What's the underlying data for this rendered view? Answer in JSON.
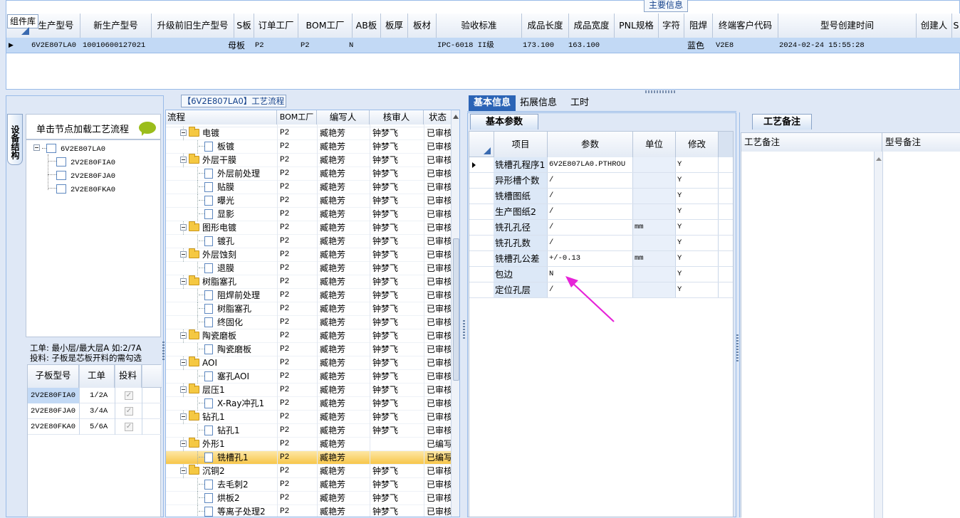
{
  "top_panel": {
    "component_lib_label": "组件库",
    "main_info_tab": "主要信息",
    "columns": [
      "生产型号",
      "新生产型号",
      "升级前旧生产型号",
      "S板",
      "订单工厂",
      "BOM工厂",
      "AB板",
      "板厚",
      "板材",
      "验收标准",
      "成品长度",
      "成品宽度",
      "PNL规格",
      "字符",
      "阻焊",
      "终端客户代码",
      "型号创建时间",
      "创建人",
      "S"
    ],
    "row": {
      "marker": "▶",
      "prod_model": "6V2E807LA0",
      "new_model": "10010600127021",
      "old_model": "",
      "s_board": "母板",
      "order_factory": "P2",
      "bom_factory": "P2",
      "ab_board": "N",
      "thickness": "",
      "material": "",
      "standard": "IPC-6018 II级",
      "length": "173.100",
      "width": "163.100",
      "pnl": "",
      "char": "",
      "solder": "蓝色",
      "customer": "V2E8",
      "created": "2024-02-24 15:55:28",
      "creator": ""
    }
  },
  "left_panel": {
    "vertical_tab": "设备结构",
    "load_hint": "单击节点加载工艺流程",
    "tree_root": "6V2E807LA0",
    "tree_children": [
      "2V2E80FIA0",
      "2V2E80FJA0",
      "2V2E80FKA0"
    ],
    "note_line1": "工单: 最小层/最大层A 如:2/7A",
    "note_line2": "投料: 子板是芯板开料的需勾选",
    "sub_table": {
      "headers": [
        "子板型号",
        "工单",
        "投料"
      ],
      "rows": [
        {
          "model": "2V2E80FIA0",
          "order": "1/2A",
          "feed": "✓"
        },
        {
          "model": "2V2E80FJA0",
          "order": "3/4A",
          "feed": "✓"
        },
        {
          "model": "2V2E80FKA0",
          "order": "5/6A",
          "feed": "✓"
        }
      ]
    }
  },
  "process_panel": {
    "title": "【6V2E807LA0】工艺流程",
    "headers": [
      "流程",
      "BOM工厂",
      "编写人",
      "核审人",
      "状态"
    ],
    "rows": [
      {
        "name": "电镀",
        "type": "folder",
        "bom": "P2",
        "writer": "臧艳芳",
        "reviewer": "钟梦飞",
        "status": "已审核"
      },
      {
        "name": "板镀",
        "type": "doc",
        "bom": "P2",
        "writer": "臧艳芳",
        "reviewer": "钟梦飞",
        "status": "已审核"
      },
      {
        "name": "外层干膜",
        "type": "folder",
        "bom": "P2",
        "writer": "臧艳芳",
        "reviewer": "钟梦飞",
        "status": "已审核"
      },
      {
        "name": "外层前处理",
        "type": "doc",
        "bom": "P2",
        "writer": "臧艳芳",
        "reviewer": "钟梦飞",
        "status": "已审核"
      },
      {
        "name": "贴膜",
        "type": "doc",
        "bom": "P2",
        "writer": "臧艳芳",
        "reviewer": "钟梦飞",
        "status": "已审核"
      },
      {
        "name": "曝光",
        "type": "doc",
        "bom": "P2",
        "writer": "臧艳芳",
        "reviewer": "钟梦飞",
        "status": "已审核"
      },
      {
        "name": "显影",
        "type": "doc",
        "bom": "P2",
        "writer": "臧艳芳",
        "reviewer": "钟梦飞",
        "status": "已审核"
      },
      {
        "name": "图形电镀",
        "type": "folder",
        "bom": "P2",
        "writer": "臧艳芳",
        "reviewer": "钟梦飞",
        "status": "已审核"
      },
      {
        "name": "镀孔",
        "type": "doc",
        "bom": "P2",
        "writer": "臧艳芳",
        "reviewer": "钟梦飞",
        "status": "已审核"
      },
      {
        "name": "外层蚀刻",
        "type": "folder",
        "bom": "P2",
        "writer": "臧艳芳",
        "reviewer": "钟梦飞",
        "status": "已审核"
      },
      {
        "name": "退膜",
        "type": "doc",
        "bom": "P2",
        "writer": "臧艳芳",
        "reviewer": "钟梦飞",
        "status": "已审核"
      },
      {
        "name": "树脂塞孔",
        "type": "folder",
        "bom": "P2",
        "writer": "臧艳芳",
        "reviewer": "钟梦飞",
        "status": "已审核"
      },
      {
        "name": "阻焊前处理",
        "type": "doc",
        "bom": "P2",
        "writer": "臧艳芳",
        "reviewer": "钟梦飞",
        "status": "已审核"
      },
      {
        "name": "树脂塞孔",
        "type": "doc",
        "bom": "P2",
        "writer": "臧艳芳",
        "reviewer": "钟梦飞",
        "status": "已审核"
      },
      {
        "name": "终固化",
        "type": "doc",
        "bom": "P2",
        "writer": "臧艳芳",
        "reviewer": "钟梦飞",
        "status": "已审核"
      },
      {
        "name": "陶瓷磨板",
        "type": "folder",
        "bom": "P2",
        "writer": "臧艳芳",
        "reviewer": "钟梦飞",
        "status": "已审核"
      },
      {
        "name": "陶瓷磨板",
        "type": "doc",
        "bom": "P2",
        "writer": "臧艳芳",
        "reviewer": "钟梦飞",
        "status": "已审核"
      },
      {
        "name": "AOI",
        "type": "folder",
        "bom": "P2",
        "writer": "臧艳芳",
        "reviewer": "钟梦飞",
        "status": "已审核"
      },
      {
        "name": "塞孔AOI",
        "type": "doc",
        "bom": "P2",
        "writer": "臧艳芳",
        "reviewer": "钟梦飞",
        "status": "已审核"
      },
      {
        "name": "层压1",
        "type": "folder",
        "bom": "P2",
        "writer": "臧艳芳",
        "reviewer": "钟梦飞",
        "status": "已审核"
      },
      {
        "name": "X-Ray冲孔1",
        "type": "doc",
        "bom": "P2",
        "writer": "臧艳芳",
        "reviewer": "钟梦飞",
        "status": "已审核"
      },
      {
        "name": "钻孔1",
        "type": "folder",
        "bom": "P2",
        "writer": "臧艳芳",
        "reviewer": "钟梦飞",
        "status": "已审核"
      },
      {
        "name": "钻孔1",
        "type": "doc",
        "bom": "P2",
        "writer": "臧艳芳",
        "reviewer": "钟梦飞",
        "status": "已审核"
      },
      {
        "name": "外形1",
        "type": "folder",
        "bom": "P2",
        "writer": "臧艳芳",
        "reviewer": "",
        "status": "已编写"
      },
      {
        "name": "铣槽孔1",
        "type": "doc",
        "bom": "P2",
        "writer": "臧艳芳",
        "reviewer": "",
        "status": "已编写",
        "selected": true
      },
      {
        "name": "沉铜2",
        "type": "folder",
        "bom": "P2",
        "writer": "臧艳芳",
        "reviewer": "钟梦飞",
        "status": "已审核"
      },
      {
        "name": "去毛刺2",
        "type": "doc",
        "bom": "P2",
        "writer": "臧艳芳",
        "reviewer": "钟梦飞",
        "status": "已审核"
      },
      {
        "name": "烘板2",
        "type": "doc",
        "bom": "P2",
        "writer": "臧艳芳",
        "reviewer": "钟梦飞",
        "status": "已审核"
      },
      {
        "name": "等离子处理2",
        "type": "doc",
        "bom": "P2",
        "writer": "臧艳芳",
        "reviewer": "钟梦飞",
        "status": "已审核"
      }
    ]
  },
  "detail_panel": {
    "tabs": [
      "基本信息",
      "拓展信息",
      "工时"
    ],
    "sub_tab": "基本参数",
    "headers": [
      "项目",
      "参数",
      "单位",
      "修改"
    ],
    "rows": [
      {
        "item": "铣槽孔程序1",
        "param": "6V2E807LA0.PTHROU",
        "unit": "",
        "mod": "Y"
      },
      {
        "item": "异形槽个数",
        "param": "/",
        "unit": "",
        "mod": "Y"
      },
      {
        "item": "铣槽图纸",
        "param": "/",
        "unit": "",
        "mod": "Y"
      },
      {
        "item": "生产图纸2",
        "param": "/",
        "unit": "",
        "mod": "Y"
      },
      {
        "item": "铣孔孔径",
        "param": "/",
        "unit": "mm",
        "mod": "Y"
      },
      {
        "item": "铣孔孔数",
        "param": "/",
        "unit": "",
        "mod": "Y"
      },
      {
        "item": "铣槽孔公差",
        "param": "+/-0.13",
        "unit": "mm",
        "mod": "Y"
      },
      {
        "item": "包边",
        "param": "N",
        "unit": "",
        "mod": "Y"
      },
      {
        "item": "定位孔层",
        "param": "/",
        "unit": "",
        "mod": "Y"
      }
    ],
    "annotation_color": "#e623d8"
  },
  "remarks_panel": {
    "tab": "工艺备注",
    "col1": "工艺备注",
    "col2": "型号备注"
  }
}
